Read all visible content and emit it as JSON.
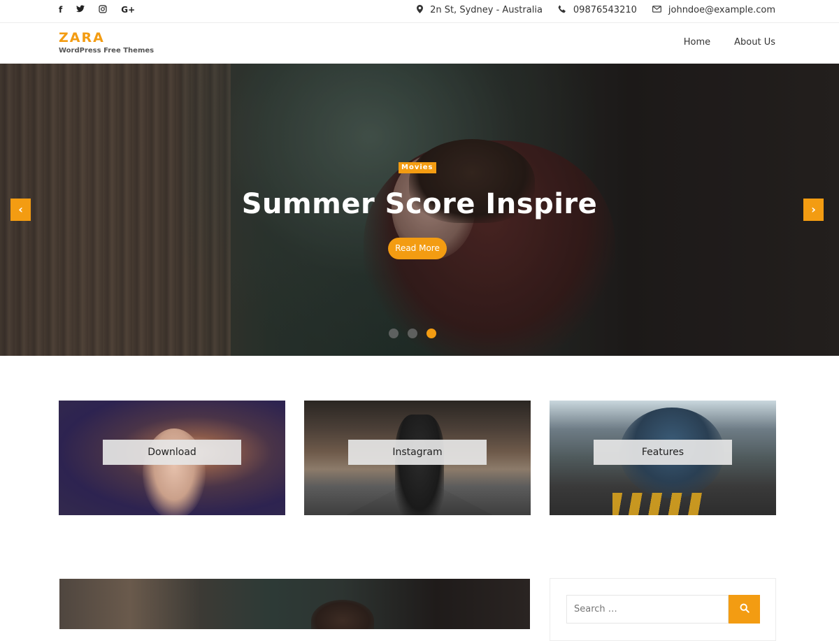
{
  "topbar": {
    "social": [
      {
        "name": "facebook",
        "glyph": "f"
      },
      {
        "name": "twitter",
        "glyph": "🐦"
      },
      {
        "name": "instagram",
        "glyph": "◎"
      },
      {
        "name": "google-plus",
        "glyph": "G+"
      }
    ],
    "address": "2n St, Sydney - Australia",
    "phone": "09876543210",
    "email": "johndoe@example.com"
  },
  "header": {
    "site_title": "ZARA",
    "tagline": "WordPress Free Themes",
    "nav": [
      "Home",
      "About Us"
    ]
  },
  "hero": {
    "category": "Movies",
    "title": "Summer Score Inspire",
    "button": "Read More",
    "prev_glyph": "‹",
    "next_glyph": "›",
    "slide_count": 3,
    "active_slide": 3
  },
  "features": [
    {
      "label": "Download"
    },
    {
      "label": "Instagram"
    },
    {
      "label": "Features"
    }
  ],
  "sidebar": {
    "search_placeholder": "Search …"
  },
  "colors": {
    "accent": "#f39c12"
  }
}
